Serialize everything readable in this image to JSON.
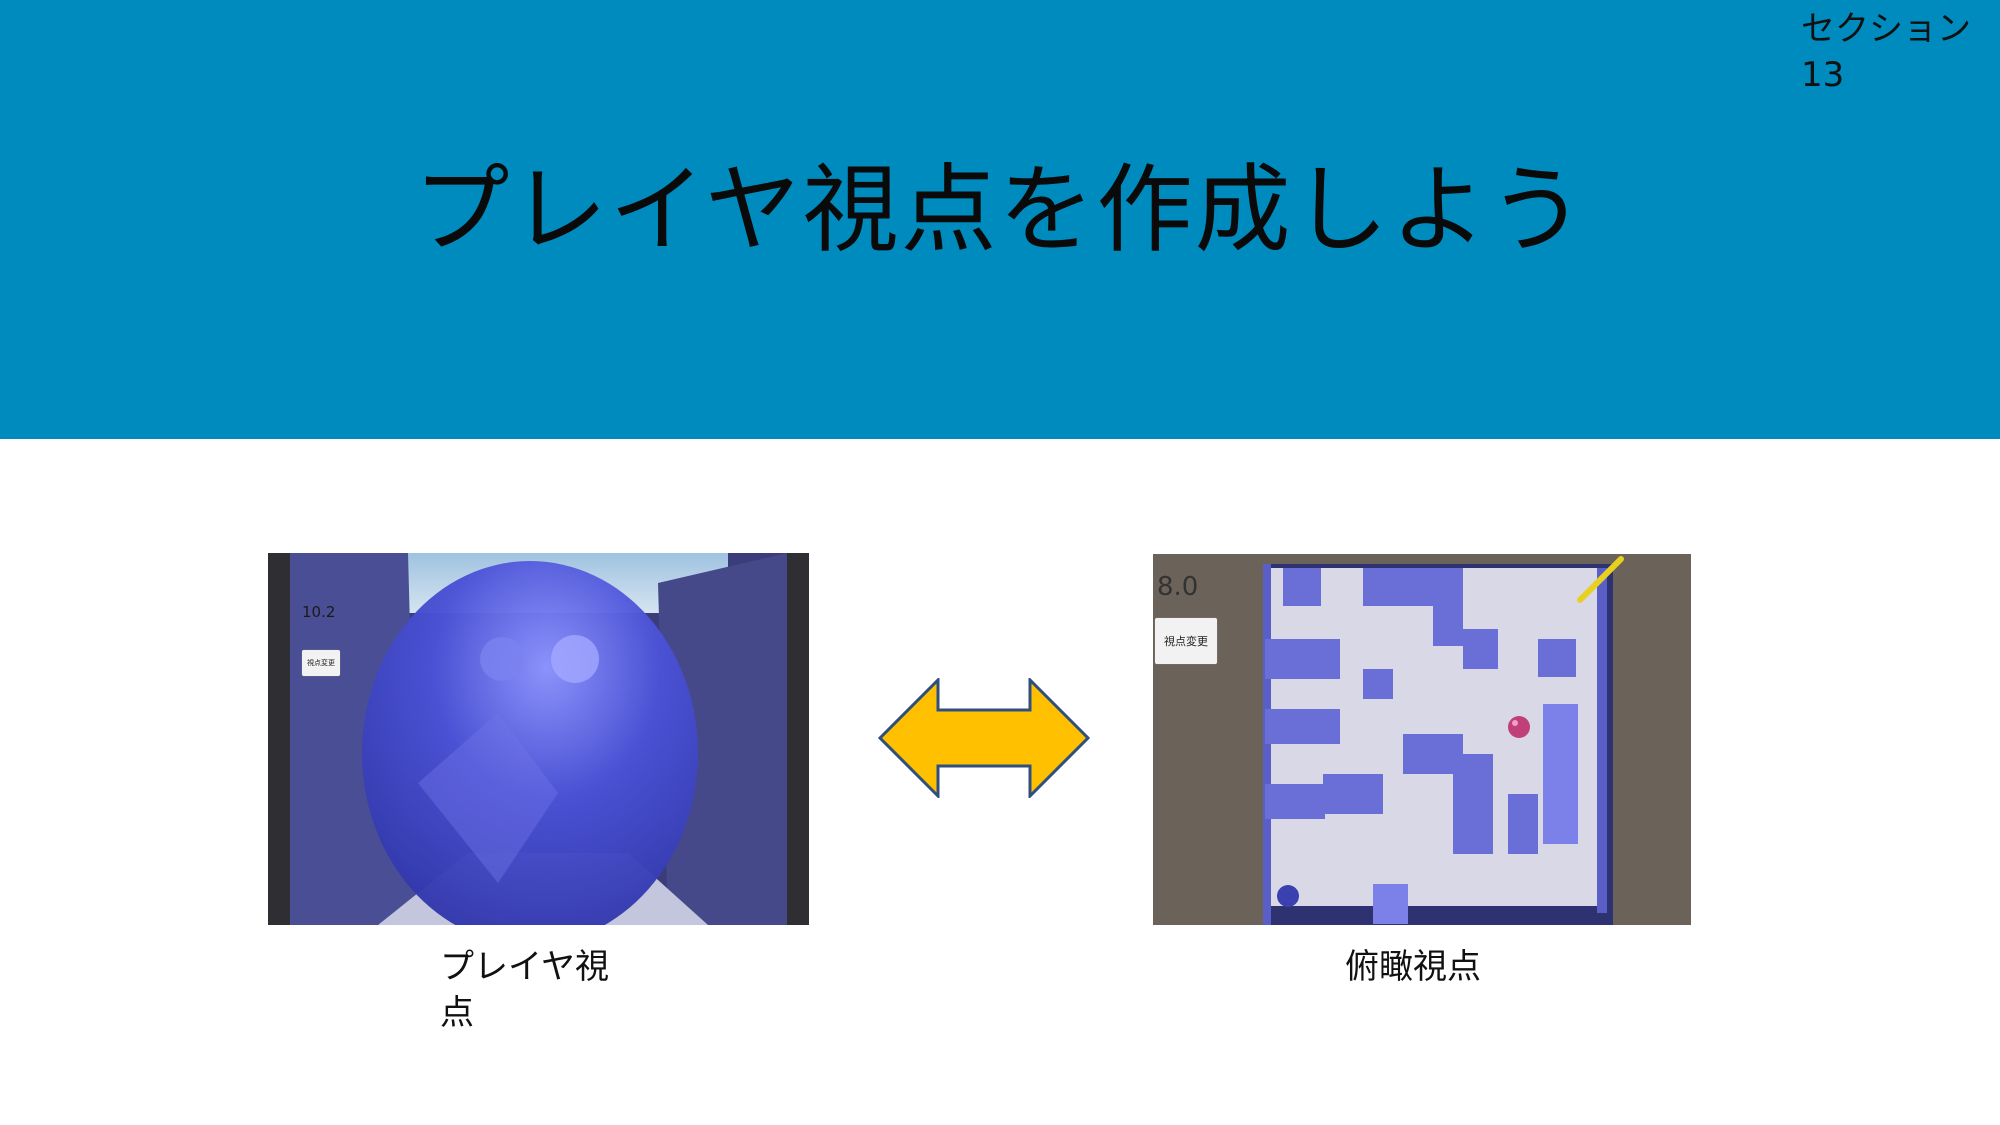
{
  "header": {
    "section_label": "セクション\n13",
    "title": "プレイヤ視点を作成しよう"
  },
  "left_screenshot": {
    "timer": "10.2",
    "button_label": "視点変更",
    "icon": "player-view-ball-icon"
  },
  "right_screenshot": {
    "timer": "8.0",
    "button_label": "視点変更",
    "icon": "top-down-maze-icon"
  },
  "arrow": {
    "icon": "double-arrow-icon",
    "fill": "#ffc000",
    "stroke": "#2f4f7f"
  },
  "captions": {
    "left": "プレイヤ視点",
    "right": "俯瞰視点"
  },
  "colors": {
    "header_bg": "#008bbf",
    "maze_wall": "#6a6fd8",
    "board_bg": "#6b625a"
  }
}
